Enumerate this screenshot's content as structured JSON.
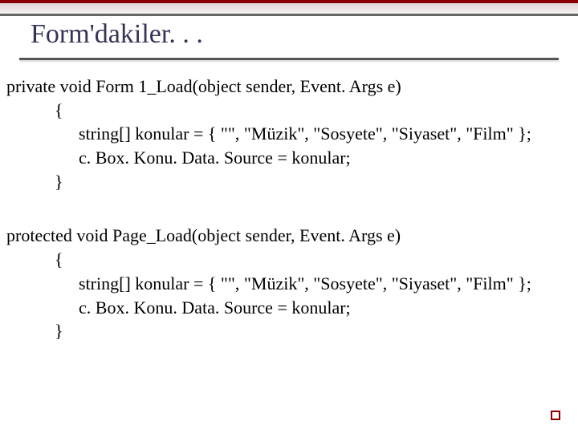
{
  "title": "Form'dakiler. . .",
  "block1": {
    "line1": "private void Form 1_Load(object sender, Event. Args e)",
    "line2": "{",
    "line3": "string[] konular = { \"\", \"Müzik\", \"Sosyete\", \"Siyaset\", \"Film\" };",
    "line4": "c. Box. Konu. Data. Source = konular;",
    "line5": "}"
  },
  "block2": {
    "line1": "protected void Page_Load(object sender, Event. Args e)",
    "line2": "{",
    "line3": "string[] konular = { \"\", \"Müzik\", \"Sosyete\", \"Siyaset\", \"Film\" };",
    "line4": "c. Box. Konu. Data. Source = konular;",
    "line5": "}"
  }
}
